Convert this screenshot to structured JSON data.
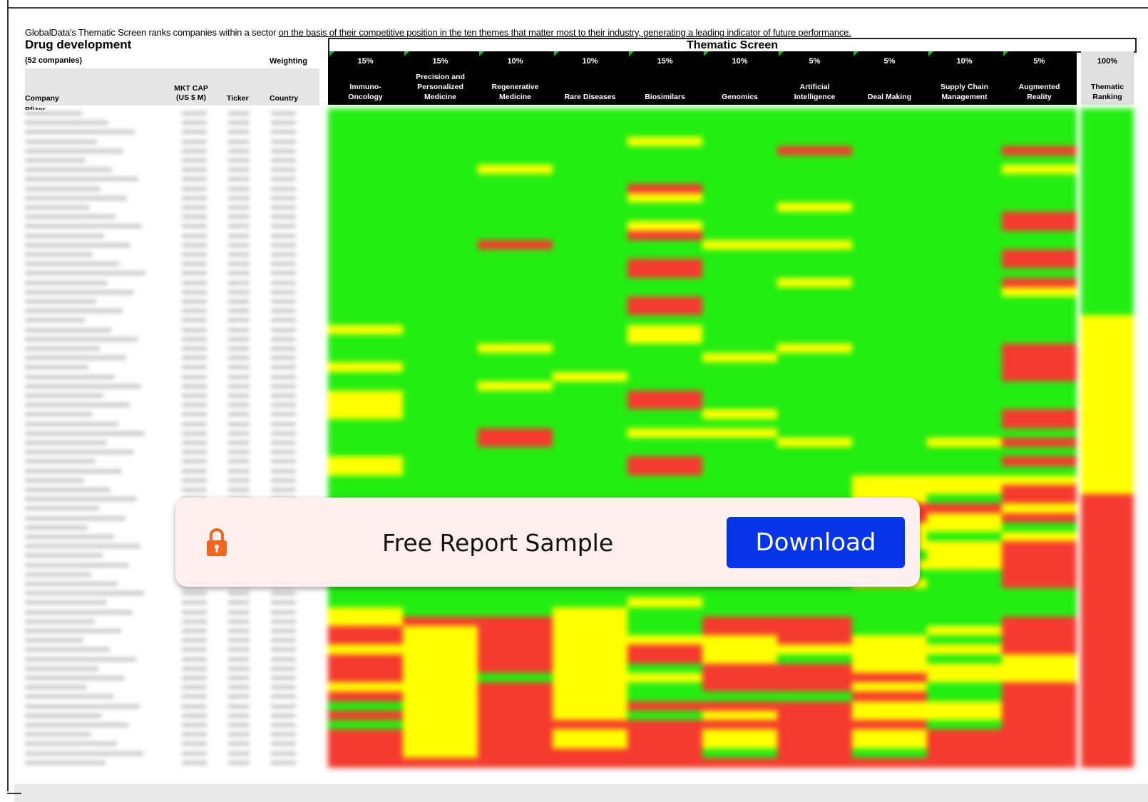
{
  "intro": {
    "prefix": "GlobalData's Thematic Screen ranks companies within a sector ",
    "underlined": "on the basis of their competitive position in the  ten themes that matter most to their industry, generating a leading indicator of future performance."
  },
  "sector": {
    "title": "Drug development",
    "count": "(52 companies)",
    "weighting_label": "Weighting"
  },
  "columns": {
    "company": "Company",
    "mktcap_line1": "MKT CAP",
    "mktcap_line2": "(US $ M)",
    "ticker": "Ticker",
    "country": "Country"
  },
  "first_row": {
    "company": "Pfizer"
  },
  "screen_title": "Thematic Screen",
  "themes": [
    {
      "weight": "15%",
      "line1": "Immuno-",
      "line2": "Oncology"
    },
    {
      "weight": "15%",
      "line1": "Precision and Personalized",
      "line2": "Medicine"
    },
    {
      "weight": "10%",
      "line1": "Regenerative",
      "line2": "Medicine"
    },
    {
      "weight": "10%",
      "line1": "",
      "line2": "Rare Diseases"
    },
    {
      "weight": "15%",
      "line1": "",
      "line2": "Biosimilars"
    },
    {
      "weight": "10%",
      "line1": "",
      "line2": "Genomics"
    },
    {
      "weight": "5%",
      "line1": "Artificial",
      "line2": "Intelligence"
    },
    {
      "weight": "5%",
      "line1": "",
      "line2": "Deal Making"
    },
    {
      "weight": "10%",
      "line1": "Supply Chain",
      "line2": "Management"
    },
    {
      "weight": "5%",
      "line1": "Augmented",
      "line2": "Reality"
    }
  ],
  "ranking": {
    "weight": "100%",
    "line1": "Thematic",
    "line2": "Ranking"
  },
  "colors": {
    "green": "#22ee11",
    "yellow": "#ffff00",
    "red": "#f53a2f",
    "header_black": "#000000",
    "button_blue": "#0535e6",
    "lock_orange": "#f26522"
  },
  "heatmap_rows": [
    "GGGGGGGGGGG",
    "GGGGGGGGGGG",
    "GGGGGGGGGGG",
    "GGGGYGGGGGG",
    "GGGGGGRGGRG",
    "GGGGGGGGGGG",
    "GGYGGGGGGYG",
    "GGGGGGGGGGG",
    "GGGGRGGGGGG",
    "GGGGYGGGGGG",
    "GGGGGGYGGGG",
    "GGGGGGGGGRG",
    "GGGGYGGGGRG",
    "GGGGRGGGGGG",
    "GGRGGYYGGGG",
    "GGGGGGGGGRG",
    "GGGGRGGGGRG",
    "GGGGRGGGGGG",
    "GGGGGGYGGRG",
    "GGGGGGGGGYG",
    "GGGGRGGGGGG",
    "GGGGRGGGGGG",
    "GGGGGGGGGGY",
    "YGGGYGGGGGY",
    "GGGGYGGGGGY",
    "GGYGGGYGGRY",
    "GGGGGYGGGRY",
    "YGGGGGGGGRY",
    "GGGYGGGGGRY",
    "GGYGGGGGGGY",
    "YGGGRGGGGGY",
    "YGGGRGGGGGY",
    "YGGGGYGGGRY",
    "GGGGGGGGGRY",
    "GGRGYYGGGGY",
    "GGRGGGYGYRY",
    "GGGGGGGGGGY",
    "YGGGRGGGGRY",
    "YGGGRGGGGGY",
    "GGGGGGGYYYY",
    "GGGGGGGYYRY",
    "GGGGGGGYGRR",
    "GGGGGGGRRYR",
    "YGGGGGGRYRR",
    "YGGGGGGYYGR",
    "GGGGGGGYGYR",
    "GGGGGGGYYRR",
    "GGGGGGGGYRR",
    "GGGGGGGYYRR",
    "GGGGGGGGGRR",
    "GGGGGGGYGRR",
    "GGGGGGGGGGR",
    "GGGGYGGGGGR",
    "YGGYGGGGGGR",
    "YRRYGRRGGRR",
    "RYRYGRRGYRR",
    "RYRYYYRYGRR",
    "YYRYRYYYYRR",
    "RYRYRYGYGYR",
    "RYRYGRRYYYR",
    "RYGYYRRRYYR",
    "YYRYGRRYGRR",
    "RYRYGGGRGRR",
    "GYRYRRRYYRR",
    "RYRYGYRYYRR",
    "GYRRRRRRGRR",
    "RYRYRYRYRRR",
    "RYRYRYRYRRR",
    "RYRRRGRGRRR",
    "RRRRRRRRRRR"
  ],
  "overlay": {
    "text": "Free Report Sample",
    "button": "Download"
  }
}
